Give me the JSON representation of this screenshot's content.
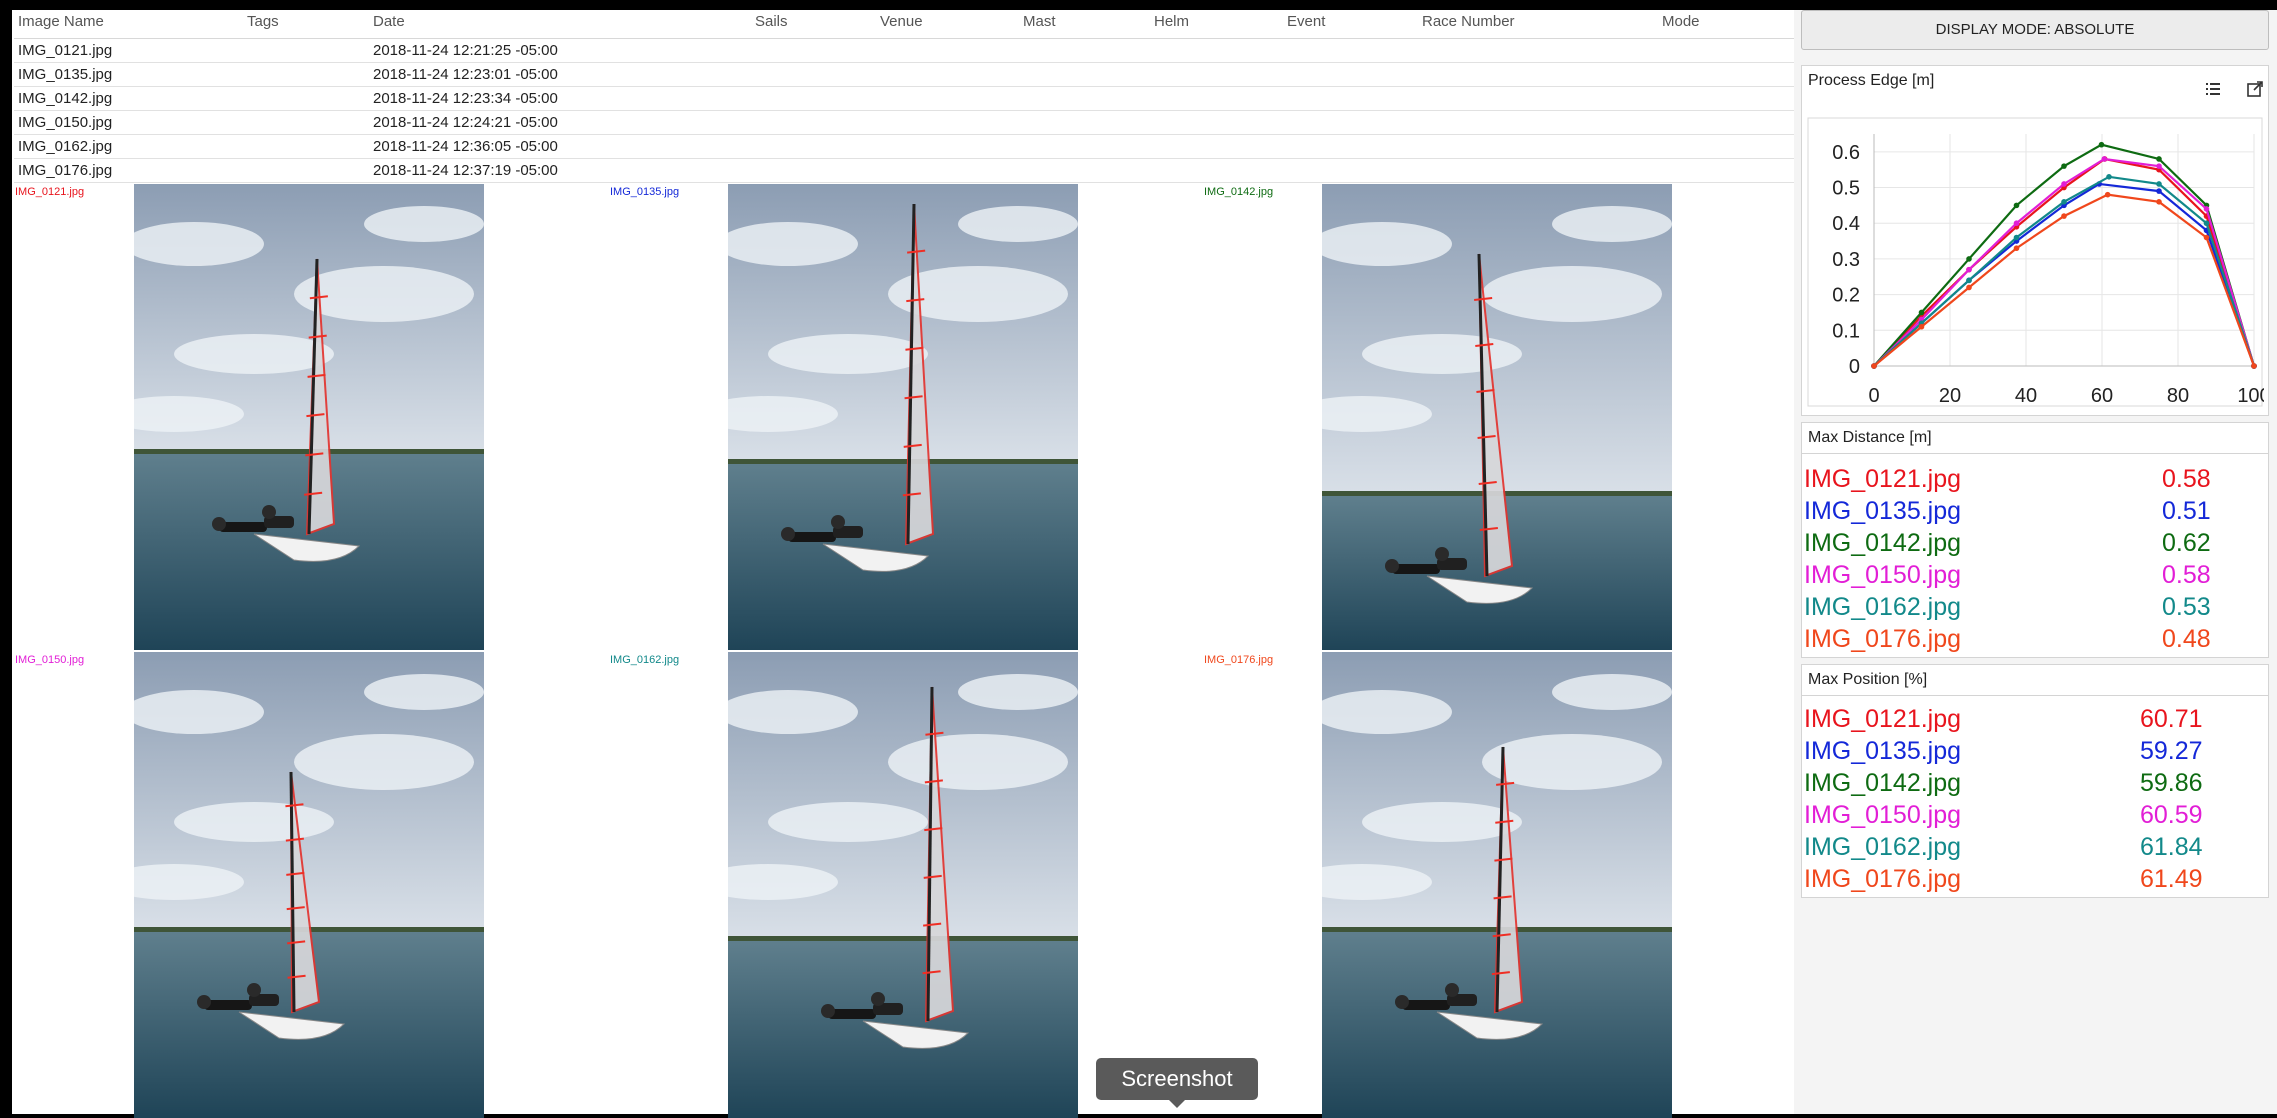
{
  "table": {
    "columns": [
      "Image Name",
      "Tags",
      "Date",
      "Sails",
      "Venue",
      "Mast",
      "Helm",
      "Event",
      "Race Number",
      "Mode"
    ],
    "rows": [
      {
        "name": "IMG_0121.jpg",
        "date": "2018-11-24 12:21:25 -05:00"
      },
      {
        "name": "IMG_0135.jpg",
        "date": "2018-11-24 12:23:01 -05:00"
      },
      {
        "name": "IMG_0142.jpg",
        "date": "2018-11-24 12:23:34 -05:00"
      },
      {
        "name": "IMG_0150.jpg",
        "date": "2018-11-24 12:24:21 -05:00"
      },
      {
        "name": "IMG_0162.jpg",
        "date": "2018-11-24 12:36:05 -05:00"
      },
      {
        "name": "IMG_0176.jpg",
        "date": "2018-11-24 12:37:19 -05:00"
      }
    ]
  },
  "grid": {
    "images": [
      {
        "label": "IMG_0121.jpg",
        "color": "#e8141d"
      },
      {
        "label": "IMG_0135.jpg",
        "color": "#1428d8"
      },
      {
        "label": "IMG_0142.jpg",
        "color": "#0e6b12"
      },
      {
        "label": "IMG_0150.jpg",
        "color": "#e21ed6"
      },
      {
        "label": "IMG_0162.jpg",
        "color": "#12898a"
      },
      {
        "label": "IMG_0176.jpg",
        "color": "#f0471c"
      }
    ]
  },
  "panel": {
    "display_mode": "DISPLAY MODE: ABSOLUTE",
    "process_edge": {
      "title": "Process Edge [m]",
      "list_icon": "list-icon",
      "open_icon": "open-external-icon"
    },
    "max_distance": {
      "title": "Max Distance [m]",
      "items": [
        {
          "name": "IMG_0121.jpg",
          "value": "0.58",
          "color": "#e8141d"
        },
        {
          "name": "IMG_0135.jpg",
          "value": "0.51",
          "color": "#1428d8"
        },
        {
          "name": "IMG_0142.jpg",
          "value": "0.62",
          "color": "#0e6b12"
        },
        {
          "name": "IMG_0150.jpg",
          "value": "0.58",
          "color": "#e21ed6"
        },
        {
          "name": "IMG_0162.jpg",
          "value": "0.53",
          "color": "#12898a"
        },
        {
          "name": "IMG_0176.jpg",
          "value": "0.48",
          "color": "#f0471c"
        }
      ]
    },
    "max_position": {
      "title": "Max Position [%]",
      "items": [
        {
          "name": "IMG_0121.jpg",
          "value": "60.71",
          "color": "#e8141d"
        },
        {
          "name": "IMG_0135.jpg",
          "value": "59.27",
          "color": "#1428d8"
        },
        {
          "name": "IMG_0142.jpg",
          "value": "59.86",
          "color": "#0e6b12"
        },
        {
          "name": "IMG_0150.jpg",
          "value": "60.59",
          "color": "#e21ed6"
        },
        {
          "name": "IMG_0162.jpg",
          "value": "61.84",
          "color": "#12898a"
        },
        {
          "name": "IMG_0176.jpg",
          "value": "61.49",
          "color": "#f0471c"
        }
      ]
    }
  },
  "tooltip": {
    "text": "Screenshot"
  },
  "chart_data": {
    "type": "line",
    "title": "",
    "xlabel": "",
    "ylabel": "",
    "xlim": [
      0,
      100
    ],
    "ylim": [
      0,
      0.65
    ],
    "xticks": [
      "0",
      "20",
      "40",
      "60",
      "80",
      "100"
    ],
    "yticks": [
      "0",
      "0.1",
      "0.2",
      "0.3",
      "0.4",
      "0.5",
      "0.6"
    ],
    "grid": true,
    "series": [
      {
        "color": "#e8141d",
        "x": [
          0,
          12.5,
          25,
          37.5,
          50,
          60.71,
          75,
          87.5,
          100
        ],
        "y": [
          0,
          0.14,
          0.27,
          0.39,
          0.5,
          0.58,
          0.55,
          0.42,
          0
        ]
      },
      {
        "color": "#1428d8",
        "x": [
          0,
          12.5,
          25,
          37.5,
          50,
          59.27,
          75,
          87.5,
          100
        ],
        "y": [
          0,
          0.12,
          0.24,
          0.35,
          0.45,
          0.51,
          0.49,
          0.38,
          0
        ]
      },
      {
        "color": "#0e6b12",
        "x": [
          0,
          12.5,
          25,
          37.5,
          50,
          59.86,
          75,
          87.5,
          100
        ],
        "y": [
          0,
          0.15,
          0.3,
          0.45,
          0.56,
          0.62,
          0.58,
          0.45,
          0
        ]
      },
      {
        "color": "#e21ed6",
        "x": [
          0,
          12.5,
          25,
          37.5,
          50,
          60.59,
          75,
          87.5,
          100
        ],
        "y": [
          0,
          0.13,
          0.27,
          0.4,
          0.51,
          0.58,
          0.56,
          0.44,
          0
        ]
      },
      {
        "color": "#12898a",
        "x": [
          0,
          12.5,
          25,
          37.5,
          50,
          61.84,
          75,
          87.5,
          100
        ],
        "y": [
          0,
          0.12,
          0.24,
          0.36,
          0.46,
          0.53,
          0.51,
          0.4,
          0
        ]
      },
      {
        "color": "#f0471c",
        "x": [
          0,
          12.5,
          25,
          37.5,
          50,
          61.49,
          75,
          87.5,
          100
        ],
        "y": [
          0,
          0.11,
          0.22,
          0.33,
          0.42,
          0.48,
          0.46,
          0.36,
          0
        ]
      }
    ]
  }
}
